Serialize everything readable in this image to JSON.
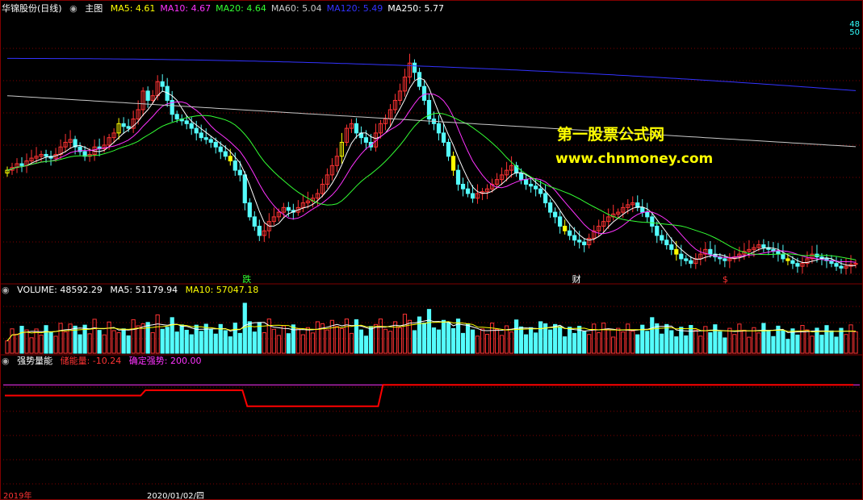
{
  "main": {
    "stock_title": "华锦股份(日线)",
    "panel_label": "主图",
    "ma_labels": [
      {
        "text": "MA5: 4.61",
        "color": "#ffff00"
      },
      {
        "text": "MA10: 4.67",
        "color": "#ff33ff"
      },
      {
        "text": "MA20: 4.64",
        "color": "#33ff33"
      },
      {
        "text": "MA60: 5.04",
        "color": "#c8c8c8"
      },
      {
        "text": "MA120: 5.49",
        "color": "#3333ff"
      },
      {
        "text": "MA250: 5.77",
        "color": "#ffffff"
      }
    ],
    "right_scale": [
      "48",
      "50"
    ],
    "markers": [
      {
        "text": "跌",
        "color": "#33ff33",
        "x_index": 49
      },
      {
        "text": "财",
        "color": "#ffffff",
        "x_index": 117
      },
      {
        "text": "$",
        "color": "#ff3333",
        "x_index": 148
      }
    ]
  },
  "volume": {
    "label": "VOLUME: 48592.29",
    "ma5": "MA5: 51179.94",
    "ma10": "MA10: 57047.18"
  },
  "indicator": {
    "name": "强势量能",
    "line1": "储能量: -10.24",
    "line2": "确定强势: 200.00"
  },
  "watermark": {
    "line1": "第一股票公式网",
    "line2": "www.chnmoney.com"
  },
  "bottom_axis": [
    "2019年",
    "2020/01/02/四"
  ],
  "colors": {
    "up": "#ff3333",
    "down": "#54fcfc",
    "highlight": "#ffff00",
    "ma5": "#ffffff",
    "ma10": "#ff33ff",
    "ma20": "#33ff33",
    "ma60": "#c8c8c8",
    "ma120": "#3333ff",
    "indicator": "#ff0000",
    "grid": "#800000"
  },
  "chart_data": {
    "type": "candlestick",
    "candles_count": 176,
    "price_range": [
      3.3,
      6.0
    ],
    "closes_approx": [
      4.45,
      4.48,
      4.52,
      4.5,
      4.55,
      4.58,
      4.6,
      4.62,
      4.6,
      4.58,
      4.62,
      4.7,
      4.75,
      4.78,
      4.7,
      4.65,
      4.6,
      4.62,
      4.7,
      4.68,
      4.72,
      4.8,
      4.85,
      4.95,
      4.92,
      4.9,
      5.0,
      5.1,
      5.3,
      5.2,
      5.25,
      5.4,
      5.35,
      5.2,
      5.05,
      5.0,
      4.98,
      4.95,
      4.9,
      4.85,
      4.8,
      4.78,
      4.75,
      4.7,
      4.65,
      4.6,
      4.55,
      4.45,
      4.4,
      4.1,
      3.95,
      3.85,
      3.75,
      3.8,
      3.9,
      3.95,
      4.0,
      4.05,
      4.02,
      4.0,
      4.05,
      4.1,
      4.12,
      4.15,
      4.2,
      4.3,
      4.4,
      4.5,
      4.6,
      4.75,
      4.9,
      4.95,
      4.85,
      4.8,
      4.75,
      4.7,
      4.85,
      4.95,
      5.0,
      5.1,
      5.2,
      5.3,
      5.45,
      5.6,
      5.5,
      5.35,
      5.2,
      5.0,
      4.95,
      4.85,
      4.75,
      4.6,
      4.45,
      4.3,
      4.25,
      4.2,
      4.15,
      4.2,
      4.22,
      4.25,
      4.3,
      4.35,
      4.4,
      4.45,
      4.5,
      4.42,
      4.35,
      4.3,
      4.28,
      4.25,
      4.2,
      4.1,
      4.0,
      3.95,
      3.85,
      3.8,
      3.75,
      3.7,
      3.68,
      3.65,
      3.72,
      3.8,
      3.85,
      3.9,
      3.95,
      3.98,
      4.0,
      4.05,
      4.08,
      4.1,
      4.05,
      4.0,
      3.95,
      3.85,
      3.75,
      3.7,
      3.65,
      3.6,
      3.55,
      3.5,
      3.48,
      3.45,
      3.5,
      3.55,
      3.6,
      3.55,
      3.52,
      3.5,
      3.48,
      3.5,
      3.52,
      3.55,
      3.58,
      3.6,
      3.62,
      3.65,
      3.62,
      3.6,
      3.58,
      3.55,
      3.5,
      3.48,
      3.45,
      3.42,
      3.45,
      3.5,
      3.55,
      3.52,
      3.5,
      3.48,
      3.45,
      3.42,
      3.4,
      3.42,
      3.44,
      3.45
    ],
    "indicator_steps": [
      {
        "from_index": 0,
        "value": 180
      },
      {
        "from_index": 29,
        "value": 190
      },
      {
        "from_index": 50,
        "value": 160
      },
      {
        "from_index": 78,
        "value": 200
      }
    ]
  }
}
